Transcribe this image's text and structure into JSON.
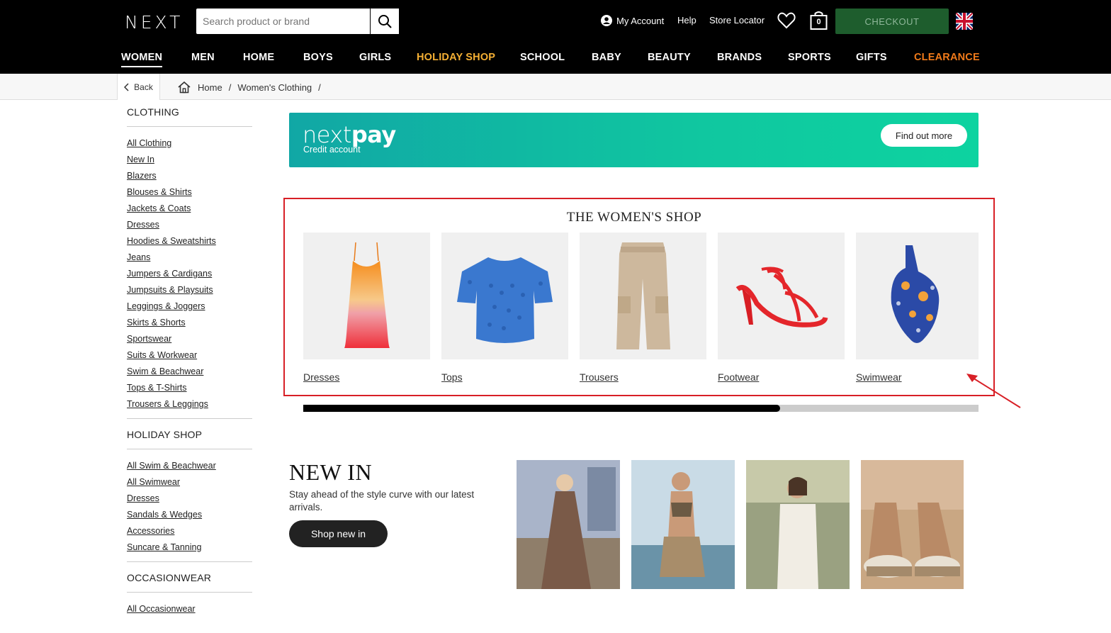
{
  "header": {
    "logo": "NEXT",
    "search_placeholder": "Search product or brand",
    "my_account": "My Account",
    "help": "Help",
    "store_locator": "Store Locator",
    "bag_count": "0",
    "checkout": "CHECKOUT"
  },
  "nav": [
    "WOMEN",
    "MEN",
    "HOME",
    "BOYS",
    "GIRLS",
    "HOLIDAY SHOP",
    "SCHOOL",
    "BABY",
    "BEAUTY",
    "BRANDS",
    "SPORTS",
    "GIFTS",
    "CLEARANCE"
  ],
  "breadcrumb": {
    "back": "Back",
    "items": [
      "Home",
      "Women's Clothing"
    ],
    "separator": "/"
  },
  "sidebar": {
    "clothing": {
      "title": "CLOTHING",
      "items": [
        "All Clothing",
        "New In",
        "Blazers",
        "Blouses & Shirts",
        "Jackets & Coats",
        "Dresses",
        "Hoodies & Sweatshirts",
        "Jeans",
        "Jumpers & Cardigans",
        "Jumpsuits & Playsuits",
        "Leggings & Joggers",
        "Skirts & Shorts",
        "Sportswear",
        "Suits & Workwear",
        "Swim & Beachwear",
        "Tops & T-Shirts",
        "Trousers & Leggings"
      ]
    },
    "holiday": {
      "title": "HOLIDAY SHOP",
      "items": [
        "All Swim & Beachwear",
        "All Swimwear",
        "Dresses",
        "Sandals & Wedges",
        "Accessories",
        "Suncare & Tanning"
      ]
    },
    "occasion": {
      "title": "OCCASIONWEAR",
      "items": [
        "All Occasionwear"
      ]
    }
  },
  "nextpay": {
    "logo_light": "next",
    "logo_bold": "pay",
    "subtitle": "Credit account",
    "button": "Find out more"
  },
  "shop": {
    "title": "THE WOMEN'S SHOP",
    "tiles": [
      "Dresses",
      "Tops",
      "Trousers",
      "Footwear",
      "Swimwear"
    ],
    "scroll_progress": 0.706
  },
  "newin": {
    "title": "NEW IN",
    "text": "Stay ahead of the style curve with our latest arrivals.",
    "button": "Shop new in"
  },
  "colors": {
    "header_bg": "#000000",
    "checkout_bg": "#1e5d2d",
    "holiday_nav": "#f5b034",
    "clearance_nav": "#f07a1a",
    "annotation": "#d81f26"
  }
}
